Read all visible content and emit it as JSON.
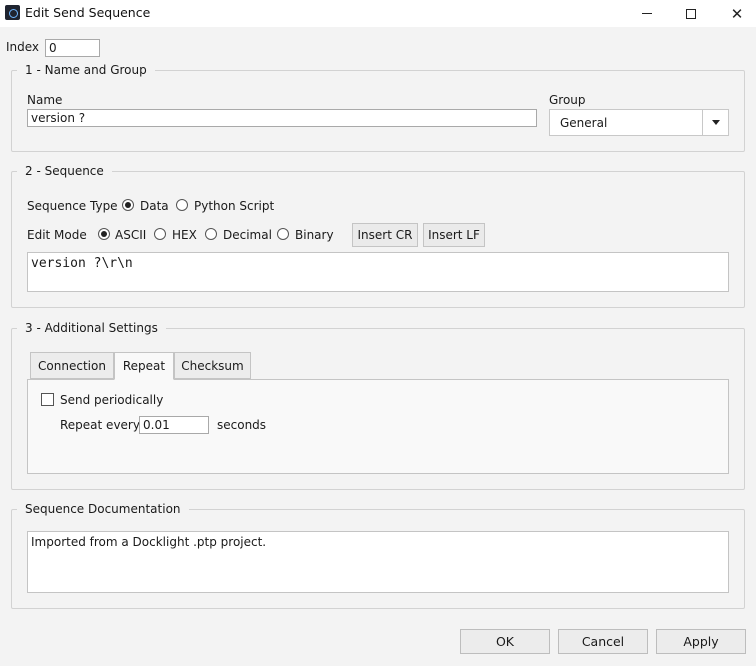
{
  "window": {
    "title": "Edit Send Sequence"
  },
  "index": {
    "label": "Index",
    "value": "0"
  },
  "group1": {
    "title": "1 - Name and Group",
    "name_label": "Name",
    "name_value": "version ?",
    "group_label": "Group",
    "group_value": "General"
  },
  "group2": {
    "title": "2 - Sequence",
    "sequence_type_label": "Sequence Type",
    "sequence_types": [
      {
        "label": "Data",
        "selected": true
      },
      {
        "label": "Python Script",
        "selected": false
      }
    ],
    "edit_mode_label": "Edit Mode",
    "edit_modes": [
      {
        "label": "ASCII",
        "selected": true
      },
      {
        "label": "HEX",
        "selected": false
      },
      {
        "label": "Decimal",
        "selected": false
      },
      {
        "label": "Binary",
        "selected": false
      }
    ],
    "insert_cr_label": "Insert CR",
    "insert_lf_label": "Insert LF",
    "sequence_text": "version ?\\r\\n"
  },
  "group3": {
    "title": "3 - Additional Settings",
    "tabs": [
      {
        "label": "Connection",
        "active": false
      },
      {
        "label": "Repeat",
        "active": true
      },
      {
        "label": "Checksum",
        "active": false
      }
    ],
    "send_periodically_label": "Send periodically",
    "send_periodically_checked": false,
    "repeat_every_label": "Repeat every",
    "repeat_every_value": "0.01",
    "seconds_label": "seconds"
  },
  "documentation": {
    "title": "Sequence Documentation",
    "text": "Imported from a Docklight .ptp project."
  },
  "footer": {
    "ok_label": "OK",
    "cancel_label": "Cancel",
    "apply_label": "Apply"
  },
  "icons": {
    "minimize": "minimize-icon",
    "maximize": "maximize-icon",
    "close": "close-icon",
    "dropdown": "chevron-down-icon"
  }
}
